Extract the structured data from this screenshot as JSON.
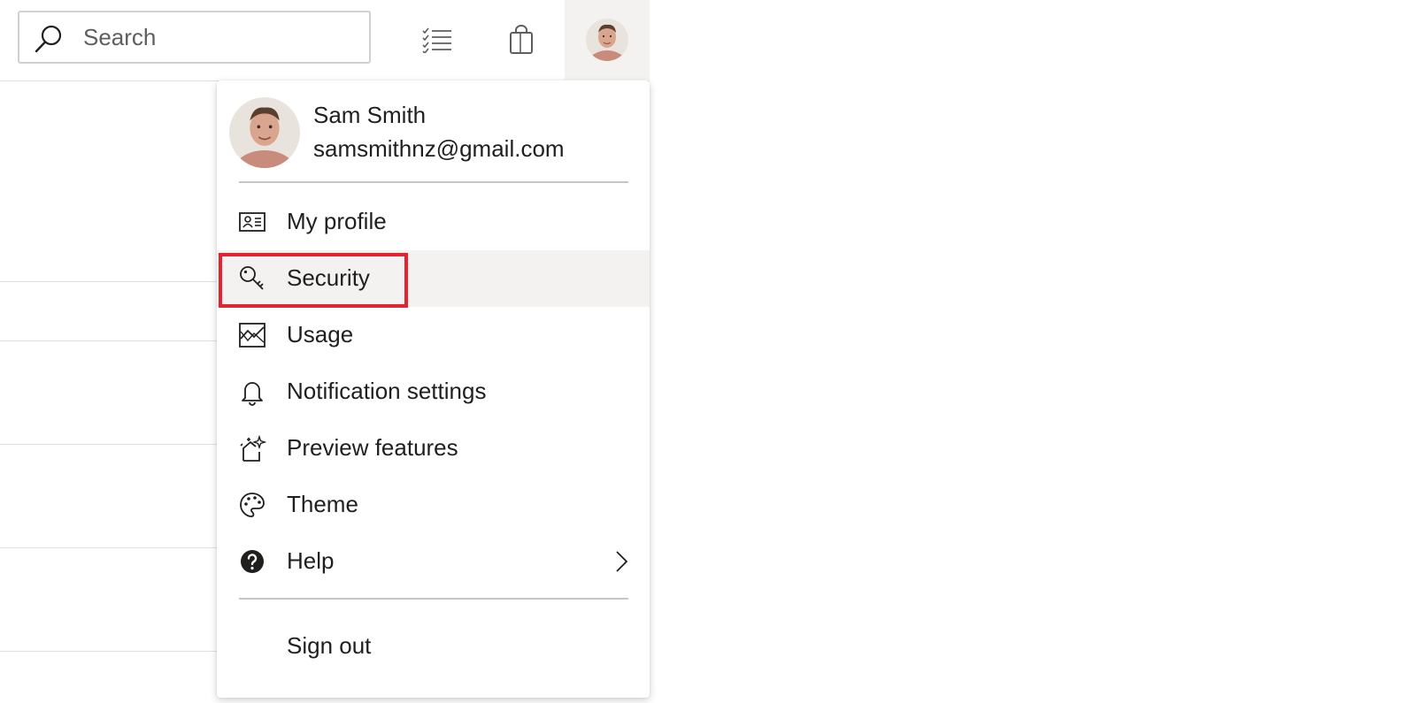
{
  "header": {
    "search": {
      "placeholder": "Search",
      "value": ""
    },
    "icons": {
      "notifications": "checklist-icon",
      "store": "shopping-bag-icon",
      "account": "avatar"
    }
  },
  "account_menu": {
    "user": {
      "name": "Sam Smith",
      "email": "samsmithnz@gmail.com"
    },
    "items": [
      {
        "label": "My profile",
        "icon": "contact-card-icon"
      },
      {
        "label": "Security",
        "icon": "key-icon",
        "highlighted": true
      },
      {
        "label": "Usage",
        "icon": "chart-icon"
      },
      {
        "label": "Notification settings",
        "icon": "bell-icon"
      },
      {
        "label": "Preview features",
        "icon": "sparkle-icon"
      },
      {
        "label": "Theme",
        "icon": "palette-icon"
      },
      {
        "label": "Help",
        "icon": "help-circle-icon",
        "submenu": true
      }
    ],
    "sign_out": {
      "label": "Sign out"
    }
  },
  "colors": {
    "highlight_border": "#e32330",
    "hover_bg": "#f3f2f1",
    "divider": "#c8c6c4",
    "text": "#201f1e"
  }
}
